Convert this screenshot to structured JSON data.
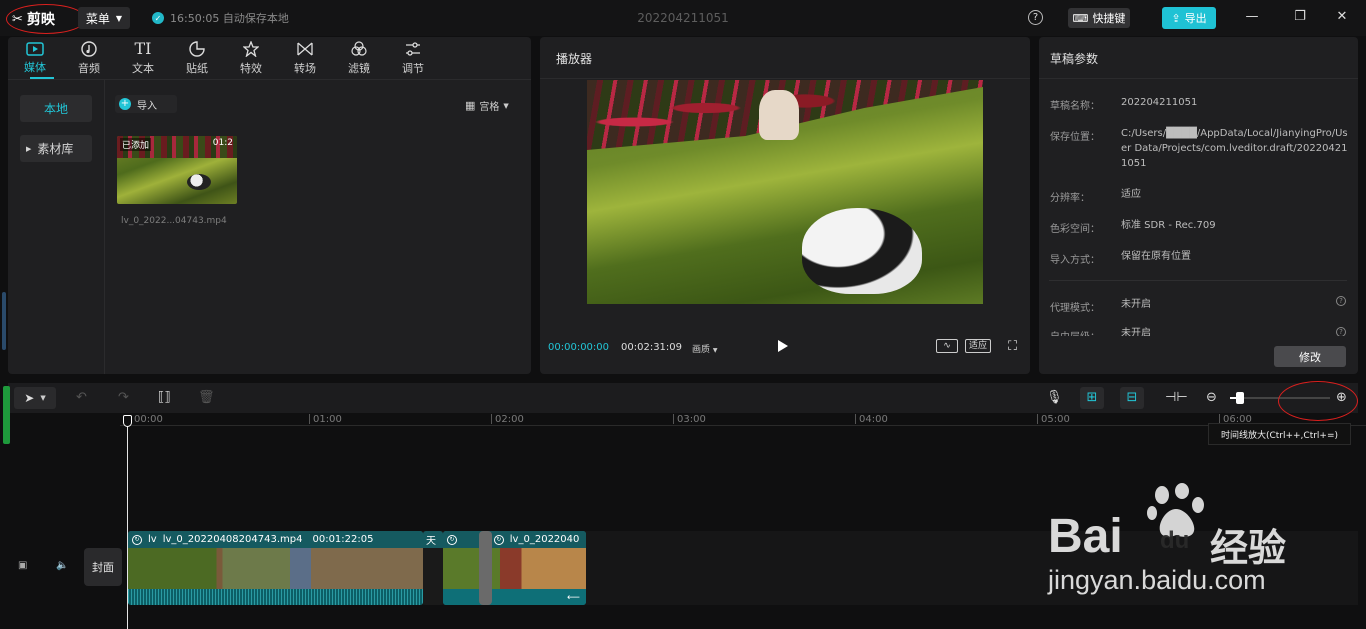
{
  "app": {
    "name": "剪映",
    "menu": "菜单",
    "autosave": "16:50:05 自动保存本地",
    "project_title": "202204211051",
    "shortcut": "快捷键",
    "export": "导出"
  },
  "media": {
    "tabs": [
      {
        "label": "媒体",
        "icon": "media-icon"
      },
      {
        "label": "音频",
        "icon": "audio-icon"
      },
      {
        "label": "文本",
        "icon": "text-icon"
      },
      {
        "label": "贴纸",
        "icon": "sticker-icon"
      },
      {
        "label": "特效",
        "icon": "effects-icon"
      },
      {
        "label": "转场",
        "icon": "transition-icon"
      },
      {
        "label": "滤镜",
        "icon": "filter-icon"
      },
      {
        "label": "调节",
        "icon": "adjust-icon"
      }
    ],
    "text_icon_glyph": "TI",
    "sidebar": {
      "local": "本地",
      "library": "素材库"
    },
    "import": "导入",
    "view_mode": "宫格",
    "item": {
      "badge": "已添加",
      "duration": "01:2",
      "filename": "lv_0_2022...04743.mp4"
    }
  },
  "player": {
    "title": "播放器",
    "current_time": "00:00:00:00",
    "total_time": "00:02:31:09",
    "quality": "画质",
    "fit": "适应"
  },
  "params": {
    "title": "草稿参数",
    "rows": [
      {
        "label": "草稿名称：",
        "value": "202204211051"
      },
      {
        "label": "保存位置：",
        "value": "C:/Users/████/AppData/Local/JianyingPro/User Data/Projects/com.lveditor.draft/202204211051"
      },
      {
        "label": "分辨率：",
        "value": "适应"
      },
      {
        "label": "色彩空间：",
        "value": "标准 SDR - Rec.709"
      },
      {
        "label": "导入方式：",
        "value": "保留在原有位置"
      },
      {
        "label": "代理模式：",
        "value": "未开启"
      },
      {
        "label": "自由层级：",
        "value": "未开启"
      }
    ],
    "edit": "修改"
  },
  "timeline": {
    "ticks": [
      "00:00",
      "01:00",
      "02:00",
      "03:00",
      "04:00",
      "05:00",
      "06:00"
    ],
    "tooltip": "时间线放大(Ctrl++,Ctrl+=)",
    "cover": "封面",
    "clip1": {
      "prefix": "lv",
      "name": "lv_0_20220408204743.mp4",
      "duration": "00:01:22:05",
      "tail": "天"
    },
    "clip2": {
      "prefix": "l",
      "name": "lv_0_2022040"
    }
  },
  "watermark": {
    "brand": "Bai",
    "du": "du",
    "cn": "经验",
    "url": "jingyan.baidu.com"
  }
}
